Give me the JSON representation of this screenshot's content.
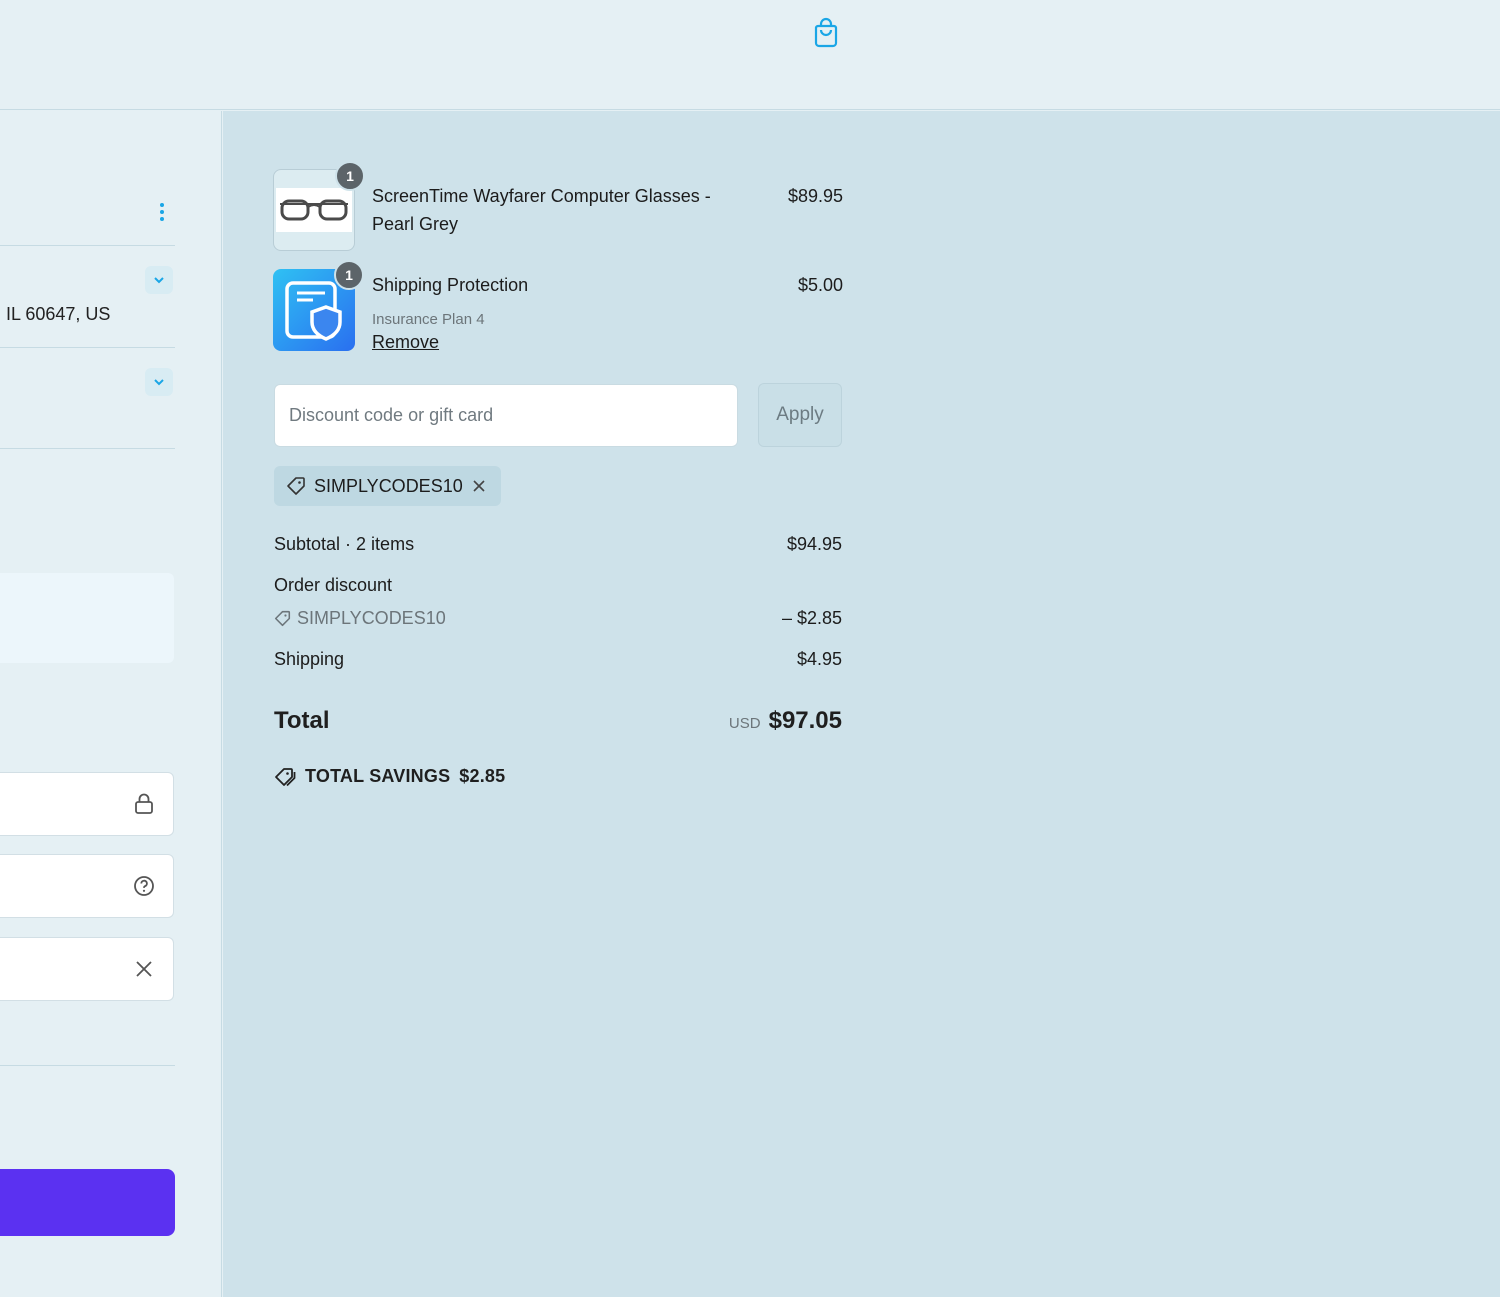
{
  "header": {
    "bag_icon": "shopping-bag-icon"
  },
  "left": {
    "address_text": "IL 60647, US"
  },
  "cart": {
    "items": [
      {
        "title": "ScreenTime Wayfarer Computer Glasses - Pearl Grey",
        "price": "$89.95",
        "quantity": "1",
        "image": "glasses-thumbnail"
      },
      {
        "title": "Shipping Protection",
        "subtitle": "Insurance Plan 4",
        "remove_label": "Remove",
        "price": "$5.00",
        "quantity": "1",
        "image": "shield-thumbnail"
      }
    ],
    "discount": {
      "placeholder": "Discount code or gift card",
      "apply_label": "Apply",
      "applied_code": "SIMPLYCODES10"
    },
    "summary": {
      "subtotal_label": "Subtotal · 2 items",
      "subtotal_value": "$94.95",
      "order_discount_label": "Order discount",
      "discount_code": "SIMPLYCODES10",
      "discount_value": "– $2.85",
      "shipping_label": "Shipping",
      "shipping_value": "$4.95",
      "total_label": "Total",
      "currency": "USD",
      "total_value": "$97.05",
      "savings_label": "TOTAL SAVINGS",
      "savings_value": "$2.85"
    }
  },
  "colors": {
    "accent": "#5b31f1",
    "icon_blue": "#1aa6e6",
    "panel_bg": "#cee2ea",
    "page_bg": "#e5f0f4"
  }
}
